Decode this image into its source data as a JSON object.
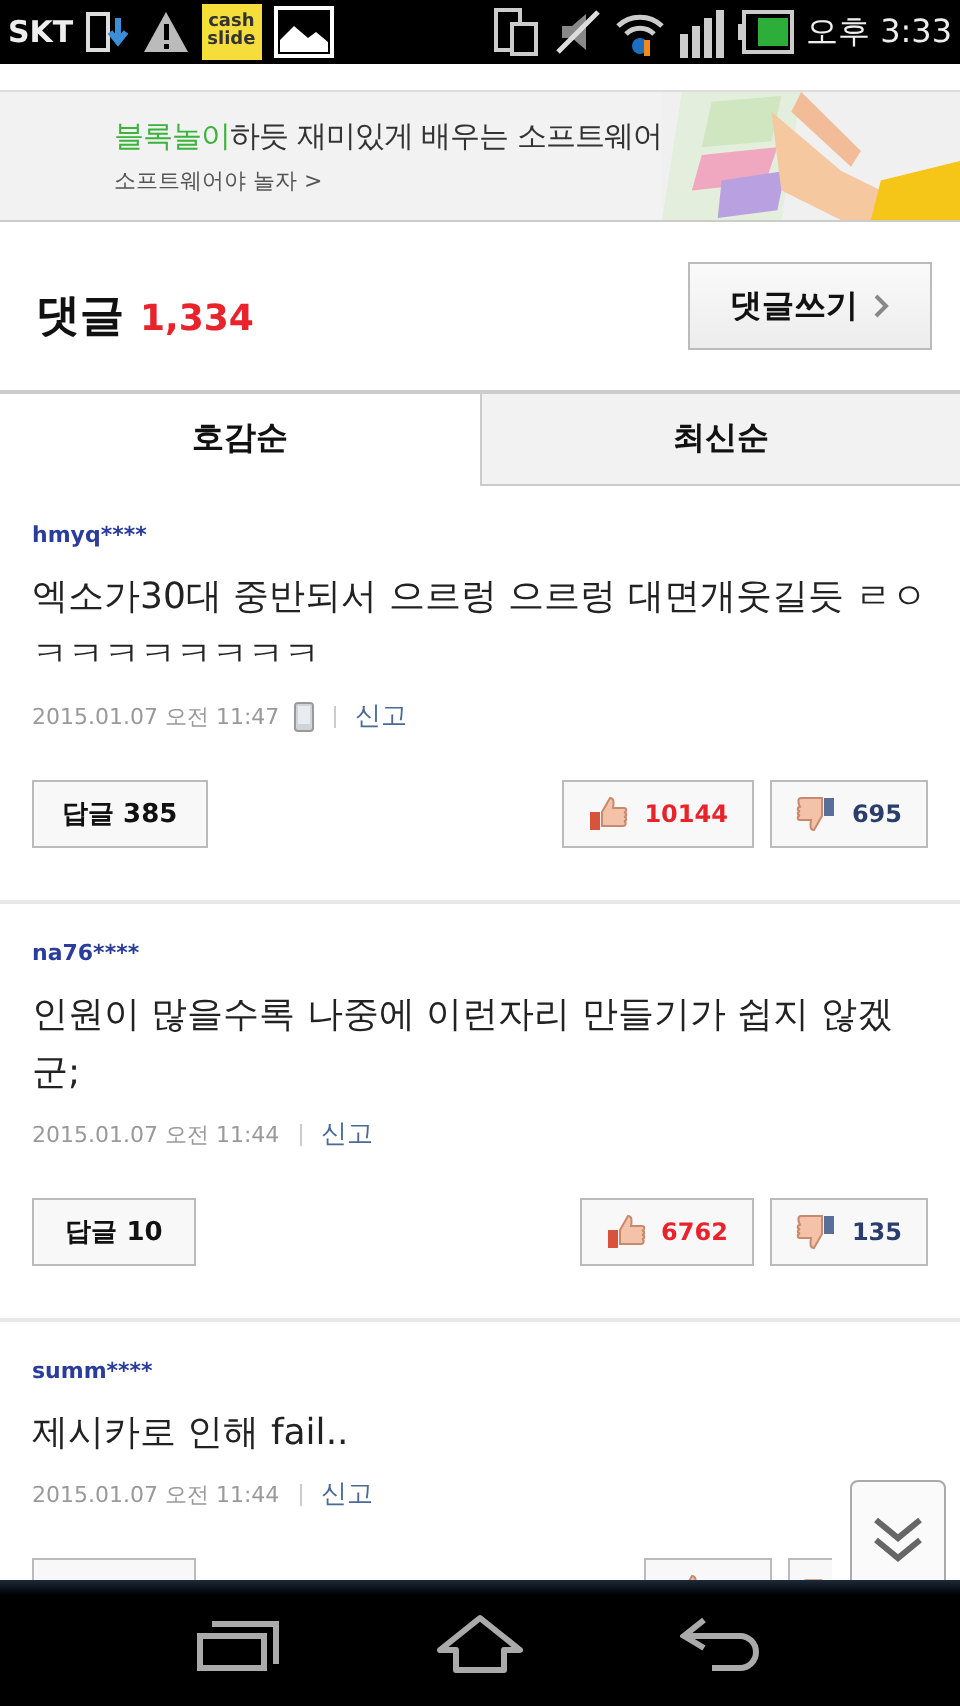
{
  "status_bar": {
    "carrier": "SKT",
    "app_badge": "cash slide",
    "time": "오후 3:33"
  },
  "banner": {
    "headline_highlight": "블록놀이",
    "headline_rest": "하듯 재미있게 배우는 소프트웨어",
    "link": "소프트웨어야 놀자 >"
  },
  "comments_header": {
    "title": "댓글",
    "count": "1,334",
    "write_button": "댓글쓰기"
  },
  "tabs": [
    {
      "label": "호감순",
      "selected": true
    },
    {
      "label": "최신순",
      "selected": false
    }
  ],
  "comments": [
    {
      "user": "hmyq****",
      "text": "엑소가30대 중반되서 으르렁 으르렁 대면개웃길듯 ㄹㅇㅋㅋㅋㅋㅋㅋㅋㅋ",
      "date": "2015.01.07 오전 11:47",
      "mobile": true,
      "report": "신고",
      "reply": "답글 385",
      "likes": "10144",
      "dislikes": "695"
    },
    {
      "user": "na76****",
      "text": "인원이 많을수록 나중에 이런자리 만들기가 쉽지 않겠군;",
      "date": "2015.01.07 오전 11:44",
      "mobile": false,
      "report": "신고",
      "reply": "답글 10",
      "likes": "6762",
      "dislikes": "135"
    },
    {
      "user": "summ****",
      "text": "제시카로 인해 fail..",
      "date": "2015.01.07 오전 11:44",
      "mobile": false,
      "report": "신고"
    }
  ]
}
